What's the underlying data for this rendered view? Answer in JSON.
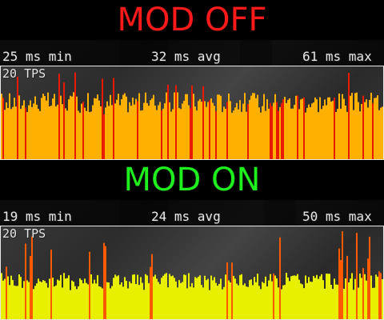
{
  "off_section": {
    "title": "MOD OFF",
    "title_color": "#ff1a1a",
    "min_label": "25 ms min",
    "avg_label": "32 ms avg",
    "max_label": "61 ms max",
    "tps_label": "20 TPS",
    "bar_color": "#ffb000",
    "spike_color": "#e81a00"
  },
  "on_section": {
    "title": "MOD ON",
    "title_color": "#1ef01e",
    "min_label": "19 ms min",
    "avg_label": "24 ms avg",
    "max_label": "50 ms max",
    "tps_label": "20 TPS",
    "bar_color": "#e8f000",
    "spike_color": "#ff5a00"
  }
}
